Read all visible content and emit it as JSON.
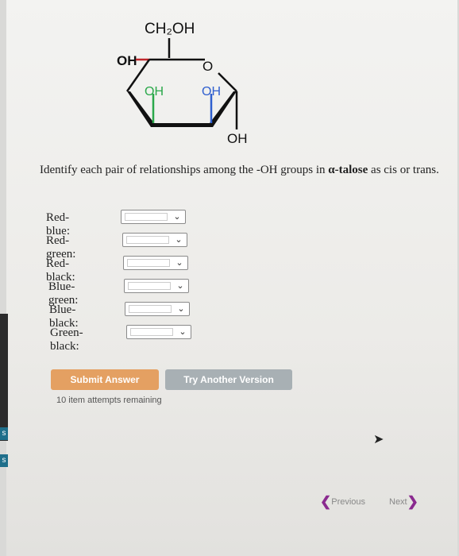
{
  "molecule": {
    "ch2oh": "CH₂OH",
    "oh_left": "OH",
    "ring_o": "O",
    "oh_green": "OH",
    "oh_blue": "OH",
    "oh_black": "OH",
    "colors": {
      "red": "#c0282d",
      "green": "#2aa84a",
      "blue": "#2f5fcf",
      "black": "#111111"
    }
  },
  "question": {
    "prefix": "Identify each pair of relationships among the -OH groups in ",
    "compound": "α-talose",
    "suffix": " as cis or trans."
  },
  "pairs": [
    {
      "label": "Red-blue:",
      "value": ""
    },
    {
      "label": "Red-green:",
      "value": ""
    },
    {
      "label": "Red-black:",
      "value": ""
    },
    {
      "label": "Blue-green:",
      "value": ""
    },
    {
      "label": "Blue-black:",
      "value": ""
    },
    {
      "label": "Green-black:",
      "value": ""
    }
  ],
  "buttons": {
    "submit": "Submit Answer",
    "try_another": "Try Another Version"
  },
  "attempts": "10 item attempts remaining",
  "nav": {
    "previous": "Previous",
    "next": "Next",
    "prev_arrow": "❮",
    "next_arrow": "❯"
  },
  "edge_tabs": [
    "s",
    "s"
  ],
  "chevron_glyph": "⌄"
}
